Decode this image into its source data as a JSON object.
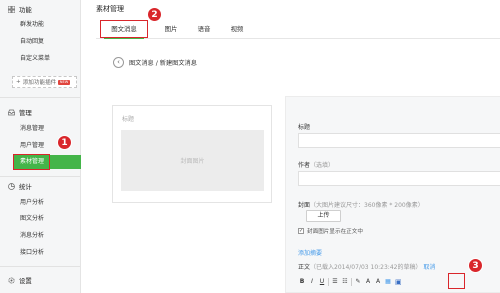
{
  "sidebar": {
    "sections": [
      {
        "title": "功能",
        "icon": "grid-icon",
        "items": [
          "群发功能",
          "自动回复",
          "自定义菜单"
        ]
      },
      {
        "title": "管理",
        "icon": "inbox-icon",
        "items": [
          "消息管理",
          "用户管理",
          "素材管理"
        ]
      },
      {
        "title": "统计",
        "icon": "chart-icon",
        "items": [
          "用户分析",
          "图文分析",
          "消息分析",
          "接口分析"
        ]
      },
      {
        "title": "设置",
        "icon": "gear-icon",
        "items": []
      }
    ],
    "add_plugin": {
      "label": "添加功能插件",
      "badge": "NEW"
    },
    "active_item": "素材管理"
  },
  "header": {
    "title": "素材管理",
    "tabs": [
      "图文消息",
      "图片",
      "语音",
      "视频"
    ],
    "active_tab": "图文消息"
  },
  "breadcrumb": "图文消息 / 新建图文消息",
  "preview": {
    "title_placeholder": "标题",
    "cover_placeholder": "封面图片"
  },
  "form": {
    "title_label": "标题",
    "author_label": "作者",
    "author_hint": "（选填）",
    "cover_label": "封面",
    "cover_hint": "（大图片建议尺寸：360像素 * 200像素）",
    "upload_label": "上传",
    "show_cover_label": "封面图片显示在正文中",
    "show_cover_checked": true,
    "add_summary": "添加摘要",
    "body_label": "正文",
    "draft_note": "（已载入2014/07/03 10:23:42的草稿）",
    "cancel": "取消"
  },
  "toolbar": [
    "B",
    "I",
    "U",
    "☰",
    "☷",
    "A",
    "A",
    "▦"
  ],
  "markers": [
    "1",
    "2",
    "3"
  ],
  "colors": {
    "accent": "#44b549",
    "highlight": "#d9262b",
    "link": "#459ae9"
  }
}
